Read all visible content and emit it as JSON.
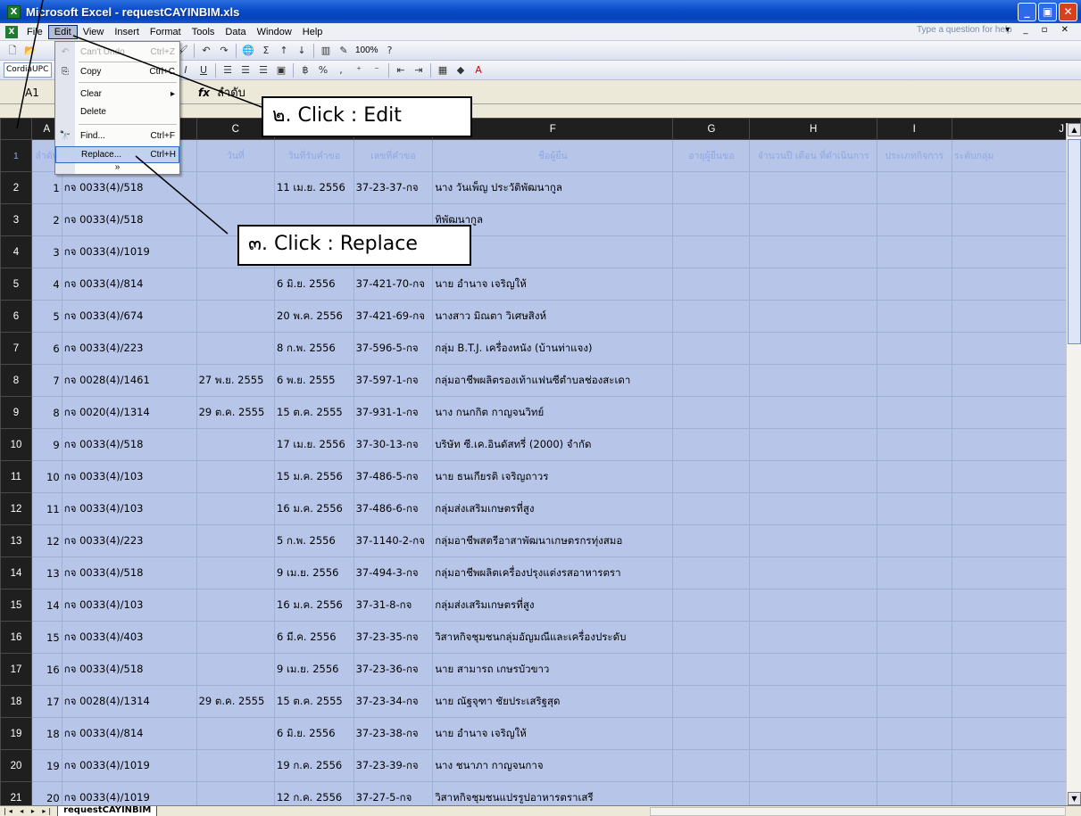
{
  "window": {
    "title": "Microsoft Excel - requestCAYINBIM.xls",
    "minimize": "_",
    "maximize": "▣",
    "close": "✕"
  },
  "menu": {
    "items": [
      "File",
      "Edit",
      "View",
      "Insert",
      "Format",
      "Tools",
      "Data",
      "Window",
      "Help"
    ],
    "ask_placeholder": "Type a question for help"
  },
  "toolbar": {
    "font": "CordiaUPC",
    "zoom": "100%"
  },
  "formula": {
    "name_box": "A1",
    "fx": "fx",
    "value": "ลำดับ"
  },
  "edit_menu": {
    "undo": {
      "label": "Can't Undo",
      "shortcut": "Ctrl+Z"
    },
    "copy": {
      "label": "Copy",
      "shortcut": "Ctrl+C"
    },
    "clear": {
      "label": "Clear",
      "shortcut": "▸"
    },
    "delete": {
      "label": "Delete"
    },
    "find": {
      "label": "Find...",
      "shortcut": "Ctrl+F"
    },
    "replace": {
      "label": "Replace...",
      "shortcut": "Ctrl+H"
    },
    "more": "»"
  },
  "callouts": {
    "edit": "๒. Click : Edit",
    "replace": "๓. Click : Replace"
  },
  "columns": [
    "A",
    "B",
    "C",
    "D",
    "E",
    "F",
    "G",
    "H",
    "I",
    "J"
  ],
  "header_row": [
    "ลำดับ",
    "",
    "วันที่",
    "วันที่รับคำขอ",
    "เลขที่คำขอ",
    "ชื่อผู้ยื่น",
    "อายุผู้ยื่นขอ",
    "จำนวนปี เดือน ที่ดำเนินการ",
    "ประเภทกิจการ",
    "ระดับกลุ่ม"
  ],
  "rows": [
    [
      "1",
      "กจ 0033(4)/518",
      "",
      "11 เม.ย. 2556",
      "37-23-37-กจ",
      "นาง วันเพ็ญ ประวัติพัฒนากูล"
    ],
    [
      "2",
      "กจ 0033(4)/518",
      "",
      "",
      "",
      "ทิพัฒนากูล"
    ],
    [
      "3",
      "กจ 0033(4)/1019",
      "",
      "",
      "",
      "นกาจ"
    ],
    [
      "4",
      "กจ 0033(4)/814",
      "",
      "6 มิ.ย. 2556",
      "37-421-70-กจ",
      "นาย อำนาจ เจริญให้"
    ],
    [
      "5",
      "กจ 0033(4)/674",
      "",
      "20 พ.ค. 2556",
      "37-421-69-กจ",
      "นางสาว มิณตา วิเศษสิงห์"
    ],
    [
      "6",
      "กจ 0033(4)/223",
      "",
      "8 ก.พ. 2556",
      "37-596-5-กจ",
      "กลุ่ม B.T.J. เครื่องหนัง (บ้านท่าแจง)"
    ],
    [
      "7",
      "กจ 0028(4)/1461",
      "27 พ.ย. 2555",
      "6 พ.ย. 2555",
      "37-597-1-กจ",
      "กลุ่มอาชีพผลิตรองเท้าแฟนซีตำบลช่องสะเดา"
    ],
    [
      "8",
      "กจ 0020(4)/1314",
      "29 ต.ค. 2555",
      "15 ต.ค. 2555",
      "37-931-1-กจ",
      "นาง กนกกิต กาญจนวิทย์"
    ],
    [
      "9",
      "กจ 0033(4)/518",
      "",
      "17 เม.ย. 2556",
      "37-30-13-กจ",
      "บริษัท ซี.เค.อินดัสทรี่ (2000) จำกัด"
    ],
    [
      "10",
      "กจ 0033(4)/103",
      "",
      "15 ม.ค. 2556",
      "37-486-5-กจ",
      "นาย ธนเกียรติ เจริญถาวร"
    ],
    [
      "11",
      "กจ 0033(4)/103",
      "",
      "16 ม.ค. 2556",
      "37-486-6-กจ",
      "กลุ่มส่งเสริมเกษตรที่สูง"
    ],
    [
      "12",
      "กจ 0033(4)/223",
      "",
      "5 ก.พ. 2556",
      "37-1140-2-กจ",
      "กลุ่มอาชีพสตรีอาสาพัฒนาเกษตรกรทุ่งสมอ"
    ],
    [
      "13",
      "กจ 0033(4)/518",
      "",
      "9 เม.ย. 2556",
      "37-494-3-กจ",
      "กลุ่มอาชีพผลิตเครื่องปรุงแต่งรสอาหารตรา"
    ],
    [
      "14",
      "กจ 0033(4)/103",
      "",
      "16 ม.ค. 2556",
      "37-31-8-กจ",
      "กลุ่มส่งเสริมเกษตรที่สูง"
    ],
    [
      "15",
      "กจ 0033(4)/403",
      "",
      "6 มี.ค. 2556",
      "37-23-35-กจ",
      "วิสาหกิจชุมชนกลุ่มอัญมณีและเครื่องประดับ"
    ],
    [
      "16",
      "กจ 0033(4)/518",
      "",
      "9 เม.ย. 2556",
      "37-23-36-กจ",
      "นาย สามารถ เกษรบัวขาว"
    ],
    [
      "17",
      "กจ 0028(4)/1314",
      "29 ต.ค. 2555",
      "15 ต.ค. 2555",
      "37-23-34-กจ",
      "นาย ณัฐจุฑา ชัยประเสริฐสุด"
    ],
    [
      "18",
      "กจ 0033(4)/814",
      "",
      "6 มิ.ย. 2556",
      "37-23-38-กจ",
      "นาย อำนาจ เจริญให้"
    ],
    [
      "19",
      "กจ 0033(4)/1019",
      "",
      "19 ก.ค. 2556",
      "37-23-39-กจ",
      "นาง ชนาภา กาญจนกาจ"
    ],
    [
      "20",
      "กจ 0033(4)/1019",
      "",
      "12 ก.ค. 2556",
      "37-27-5-กจ",
      "วิสาหกิจชุมชนแปรรูปอาหารตราเสรี"
    ]
  ],
  "sheet_tab": "requestCAYINBIM",
  "sheet_nav": "|◂ ◂ ▸ ▸|"
}
